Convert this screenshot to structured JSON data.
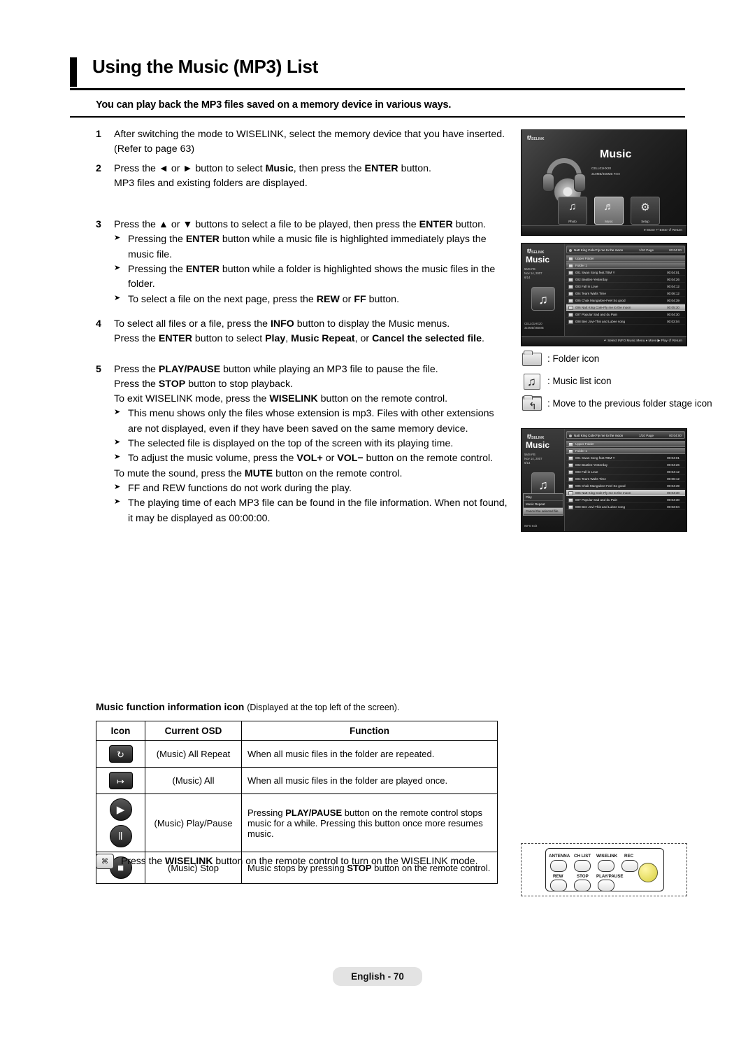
{
  "page": {
    "title": "Using the Music (MP3) List",
    "subtitle": "You can play back the MP3 files saved on a memory device in various ways.",
    "footer": "English - 70"
  },
  "steps": [
    {
      "num": "1",
      "lines": [
        "After switching the mode to WISELINK, select the memory device that you have inserted. (Refer to page 63)"
      ]
    },
    {
      "num": "2",
      "lines": [
        "Press the ◄ or ► button to select Music, then press the ENTER button.",
        "MP3 files and existing folders are displayed."
      ]
    },
    {
      "num": "3",
      "lines": [
        "Press the ▲ or ▼ buttons to select a file to be played, then press the ENTER button."
      ],
      "bullets": [
        "Pressing the ENTER button while a music file is highlighted immediately plays the music file.",
        "Pressing the ENTER button while a folder is highlighted shows the music files in the folder.",
        "To select a file on the next page, press the REW or FF button."
      ]
    },
    {
      "num": "4",
      "lines": [
        "To select all files or a file, press the INFO button to display the Music menus.",
        "Press the ENTER button to select Play, Music Repeat, or Cancel the selected file."
      ]
    },
    {
      "num": "5",
      "lines": [
        "Press the PLAY/PAUSE button while playing an MP3 file to pause the file.",
        "Press the STOP button to stop playback.",
        "To exit WISELINK mode, press the WISELINK button on the remote control."
      ],
      "bullets": [
        "This menu shows only the files whose extension is mp3. Files with other extensions are not displayed, even if they have been saved on the same memory device.",
        "The selected file is displayed on the top of the screen with its playing time.",
        "To adjust the music volume, press the VOL+ or VOL− button on the remote control."
      ],
      "trailing": "To mute the sound, press the MUTE button on the remote control.",
      "bullets2": [
        "FF and REW functions do not work during the play.",
        "The playing time of each MP3 file can be found in the file information. When not found, it may be displayed as 00:00:00."
      ]
    }
  ],
  "legend": [
    {
      "icon": "folder-icon",
      "label": ": Folder icon"
    },
    {
      "icon": "music-list-icon",
      "label": ": Music list icon"
    },
    {
      "icon": "move-previous-folder-icon",
      "label": ": Move to the previous folder stage icon"
    }
  ],
  "icon_table": {
    "heading_bold": "Music function information icon",
    "heading_rest": "(Displayed at the top left of the screen).",
    "columns": [
      "Icon",
      "Current OSD",
      "Function"
    ],
    "rows": [
      {
        "icon_glyph": "↻",
        "icon_name": "music-all-repeat-icon",
        "osd": "(Music) All Repeat",
        "function": "When all music files in the folder are repeated."
      },
      {
        "icon_glyph": "↦",
        "icon_name": "music-all-icon",
        "osd": "(Music) All",
        "function": "When all music files in the folder are played once."
      },
      {
        "icon_glyph": "▶",
        "icon_glyph2": "‖",
        "icon_name": "music-play-pause-icon",
        "osd": "(Music) Play/Pause",
        "function": "Pressing PLAY/PAUSE button on the remote control stops music for a while. Pressing this button once more resumes music."
      },
      {
        "icon_glyph": "■",
        "icon_name": "music-stop-icon",
        "osd": "(Music) Stop",
        "function": "Music stops by pressing STOP button on the remote control."
      }
    ]
  },
  "remote_note": {
    "icon_label": "⌘",
    "text": "Press the WISELINK button on the remote control to turn on the WISELINK mode."
  },
  "remote_diagram": {
    "top_keys": [
      "ANTENNA",
      "CH LIST",
      "WISELINK",
      "REC"
    ],
    "bottom_keys": [
      "REW",
      "STOP",
      "PLAY/PAUSE"
    ]
  },
  "osd1": {
    "brand": "WISELINK",
    "title": "Music",
    "device_line1": "CELL01HX20",
    "device_line2": "310MB/465MB Free",
    "tiles": [
      {
        "name": "photo-tile",
        "glyph": "♫",
        "caption": "Photo"
      },
      {
        "name": "music-tile",
        "glyph": "♬",
        "caption": "Music"
      },
      {
        "name": "setup-tile",
        "glyph": "⚙",
        "caption": "Setup"
      }
    ],
    "footer": "♦ Move   ↵ Enter   ↺ Return"
  },
  "osd2": {
    "brand": "WISELINK",
    "title": "Music",
    "meta": "5MS-FB\nNov 14, 2007\n6/14",
    "device": "CELL01HX20\n310MB/465MB",
    "nowplaying": "Natt King Cole:Fly me to the moon",
    "nowplaying_page": "1/10 Page",
    "nowplaying_time": "00:04:00",
    "rows": [
      {
        "text": "Upper Folder",
        "time": "",
        "kind": "folder"
      },
      {
        "text": "Folder 1",
        "time": "",
        "kind": "folder"
      },
      {
        "text": "001 Swan Song feat.TBM Y",
        "time": "00:04:01",
        "kind": "music"
      },
      {
        "text": "002 Beatles-Yesterday",
        "time": "00:04:26",
        "kind": "music"
      },
      {
        "text": "003 Fall in Love",
        "time": "00:04:12",
        "kind": "music"
      },
      {
        "text": "004 Tears Walts Time",
        "time": "00:06:12",
        "kind": "music"
      },
      {
        "text": "005 Chak Mangalore-Feel So good",
        "time": "00:04:39",
        "kind": "music"
      },
      {
        "text": "006 Natt King Cole-Fly me to the moon",
        "time": "00:05:30",
        "kind": "music"
      },
      {
        "text": "007 Popular Sad and du Pain",
        "time": "00:04:30",
        "kind": "music"
      },
      {
        "text": "008 Ben Jovi-This and Lubee song",
        "time": "00:03:04",
        "kind": "music"
      }
    ],
    "footer": "↵ Select   INFO Music Menu   ♦ Move   ▶ Play   ↺ Return"
  },
  "osd3": {
    "brand": "WISELINK",
    "title": "Music",
    "meta": "5MS-FB\nNov 14, 2007\n6/14",
    "nowplaying": "Natt King Cole:Fly me to the moon",
    "nowplaying_page": "1/10 Page",
    "nowplaying_time": "00:04:00",
    "rows": [
      {
        "text": "Upper Folder",
        "time": "",
        "kind": "folder"
      },
      {
        "text": "Folder 1",
        "time": "",
        "kind": "folder"
      },
      {
        "text": "001 Swan Song feat.TBM Y",
        "time": "00:04:01",
        "kind": "music"
      },
      {
        "text": "002 Beatles-Yesterday",
        "time": "00:04:26",
        "kind": "music"
      },
      {
        "text": "003 Fall in Love",
        "time": "00:04:12",
        "kind": "music"
      },
      {
        "text": "004 Tears Walts Time",
        "time": "00:06:12",
        "kind": "music"
      },
      {
        "text": "005 Chak Mangalore-Feel So good",
        "time": "00:04:39",
        "kind": "music"
      },
      {
        "text": "006 Natt King Cole-Fly me to the moon",
        "time": "00:04:30",
        "kind": "music"
      },
      {
        "text": "007 Popular Sad and du Pain",
        "time": "00:04:30",
        "kind": "music"
      },
      {
        "text": "008 Ben Jovi-This and Lubee song",
        "time": "00:03:04",
        "kind": "music"
      }
    ],
    "menu": [
      {
        "label": "Play",
        "selected": false
      },
      {
        "label": "Music Repeat",
        "selected": false
      },
      {
        "label": "Cancel the selected file",
        "selected": true
      }
    ],
    "footer": "INFO Exit"
  }
}
